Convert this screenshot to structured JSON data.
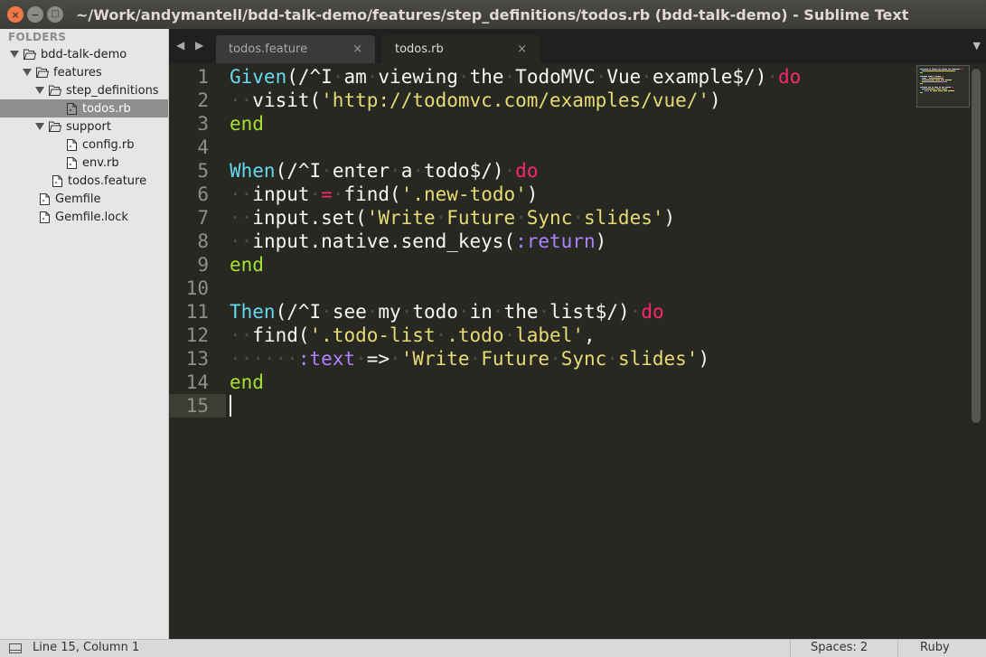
{
  "window": {
    "title": "~/Work/andymantell/bdd-talk-demo/features/step_definitions/todos.rb (bdd-talk-demo) - Sublime Text",
    "close_glyph": "×",
    "minimize_glyph": "−",
    "maximize_glyph": "□"
  },
  "sidebar": {
    "header": "FOLDERS",
    "items": [
      {
        "label": "bdd-talk-demo",
        "kind": "folder",
        "expanded": true,
        "depth": 0
      },
      {
        "label": "features",
        "kind": "folder",
        "expanded": true,
        "depth": 1
      },
      {
        "label": "step_definitions",
        "kind": "folder",
        "expanded": true,
        "depth": 2
      },
      {
        "label": "todos.rb",
        "kind": "file",
        "selected": true,
        "depth": 3
      },
      {
        "label": "support",
        "kind": "folder",
        "expanded": true,
        "depth": 2
      },
      {
        "label": "config.rb",
        "kind": "file",
        "depth": 3
      },
      {
        "label": "env.rb",
        "kind": "file",
        "depth": 3
      },
      {
        "label": "todos.feature",
        "kind": "file",
        "depth": 2
      },
      {
        "label": "Gemfile",
        "kind": "file",
        "depth": 1
      },
      {
        "label": "Gemfile.lock",
        "kind": "file",
        "depth": 1
      }
    ]
  },
  "tabs": {
    "nav_glyphs": "◀ ▶",
    "close_glyph": "×",
    "menu_glyph": "▼",
    "items": [
      {
        "label": "todos.feature",
        "active": false
      },
      {
        "label": "todos.rb",
        "active": true
      }
    ]
  },
  "editor": {
    "line_numbers": [
      "1",
      "2",
      "3",
      "4",
      "5",
      "6",
      "7",
      "8",
      "9",
      "10",
      "11",
      "12",
      "13",
      "14",
      "15"
    ],
    "current_line": 15,
    "lines": [
      [
        {
          "t": "Given",
          "c": "class"
        },
        {
          "t": "(/^I"
        },
        {
          "t": "·",
          "c": "ws"
        },
        {
          "t": "am"
        },
        {
          "t": "·",
          "c": "ws"
        },
        {
          "t": "viewing"
        },
        {
          "t": "·",
          "c": "ws"
        },
        {
          "t": "the"
        },
        {
          "t": "·",
          "c": "ws"
        },
        {
          "t": "TodoMVC"
        },
        {
          "t": "·",
          "c": "ws"
        },
        {
          "t": "Vue"
        },
        {
          "t": "·",
          "c": "ws"
        },
        {
          "t": "example$/)"
        },
        {
          "t": "·",
          "c": "ws"
        },
        {
          "t": "do",
          "c": "kw"
        }
      ],
      [
        {
          "t": "··",
          "c": "ws"
        },
        {
          "t": "visit("
        },
        {
          "t": "'http://todomvc.com/examples/vue/'",
          "c": "str"
        },
        {
          "t": ")"
        }
      ],
      [
        {
          "t": "end",
          "c": "end"
        }
      ],
      [],
      [
        {
          "t": "When",
          "c": "class"
        },
        {
          "t": "(/^I"
        },
        {
          "t": "·",
          "c": "ws"
        },
        {
          "t": "enter"
        },
        {
          "t": "·",
          "c": "ws"
        },
        {
          "t": "a"
        },
        {
          "t": "·",
          "c": "ws"
        },
        {
          "t": "todo$/)"
        },
        {
          "t": "·",
          "c": "ws"
        },
        {
          "t": "do",
          "c": "kw"
        }
      ],
      [
        {
          "t": "··",
          "c": "ws"
        },
        {
          "t": "input"
        },
        {
          "t": "·",
          "c": "ws"
        },
        {
          "t": "=",
          "c": "kw"
        },
        {
          "t": "·",
          "c": "ws"
        },
        {
          "t": "find("
        },
        {
          "t": "'.new-todo'",
          "c": "str"
        },
        {
          "t": ")"
        }
      ],
      [
        {
          "t": "··",
          "c": "ws"
        },
        {
          "t": "input.set("
        },
        {
          "t": "'Write",
          "c": "str"
        },
        {
          "t": "·",
          "c": "ws"
        },
        {
          "t": "Future",
          "c": "str"
        },
        {
          "t": "·",
          "c": "ws"
        },
        {
          "t": "Sync",
          "c": "str"
        },
        {
          "t": "·",
          "c": "ws"
        },
        {
          "t": "slides'",
          "c": "str"
        },
        {
          "t": ")"
        }
      ],
      [
        {
          "t": "··",
          "c": "ws"
        },
        {
          "t": "input.native.send_keys("
        },
        {
          "t": ":return",
          "c": "sym"
        },
        {
          "t": ")"
        }
      ],
      [
        {
          "t": "end",
          "c": "end"
        }
      ],
      [],
      [
        {
          "t": "Then",
          "c": "class"
        },
        {
          "t": "(/^I"
        },
        {
          "t": "·",
          "c": "ws"
        },
        {
          "t": "see"
        },
        {
          "t": "·",
          "c": "ws"
        },
        {
          "t": "my"
        },
        {
          "t": "·",
          "c": "ws"
        },
        {
          "t": "todo"
        },
        {
          "t": "·",
          "c": "ws"
        },
        {
          "t": "in"
        },
        {
          "t": "·",
          "c": "ws"
        },
        {
          "t": "the"
        },
        {
          "t": "·",
          "c": "ws"
        },
        {
          "t": "list$/)"
        },
        {
          "t": "·",
          "c": "ws"
        },
        {
          "t": "do",
          "c": "kw"
        }
      ],
      [
        {
          "t": "··",
          "c": "ws"
        },
        {
          "t": "find("
        },
        {
          "t": "'.todo-list",
          "c": "str"
        },
        {
          "t": "·",
          "c": "ws"
        },
        {
          "t": ".todo",
          "c": "str"
        },
        {
          "t": "·",
          "c": "ws"
        },
        {
          "t": "label'",
          "c": "str"
        },
        {
          "t": ","
        }
      ],
      [
        {
          "t": "······",
          "c": "ws"
        },
        {
          "t": ":text",
          "c": "sym"
        },
        {
          "t": "·",
          "c": "ws"
        },
        {
          "t": "=>"
        },
        {
          "t": "·",
          "c": "ws"
        },
        {
          "t": "'Write",
          "c": "str"
        },
        {
          "t": "·",
          "c": "ws"
        },
        {
          "t": "Future",
          "c": "str"
        },
        {
          "t": "·",
          "c": "ws"
        },
        {
          "t": "Sync",
          "c": "str"
        },
        {
          "t": "·",
          "c": "ws"
        },
        {
          "t": "slides'",
          "c": "str"
        },
        {
          "t": ")"
        }
      ],
      [
        {
          "t": "end",
          "c": "end"
        }
      ],
      []
    ]
  },
  "status": {
    "position": "Line 15, Column 1",
    "indentation": "Spaces: 2",
    "syntax": "Ruby"
  },
  "colors": {
    "background": "#272822",
    "class": "#66d9ef",
    "keyword": "#f92672",
    "end": "#a6e22e",
    "string": "#e6db74",
    "symbol": "#ae81ff"
  }
}
